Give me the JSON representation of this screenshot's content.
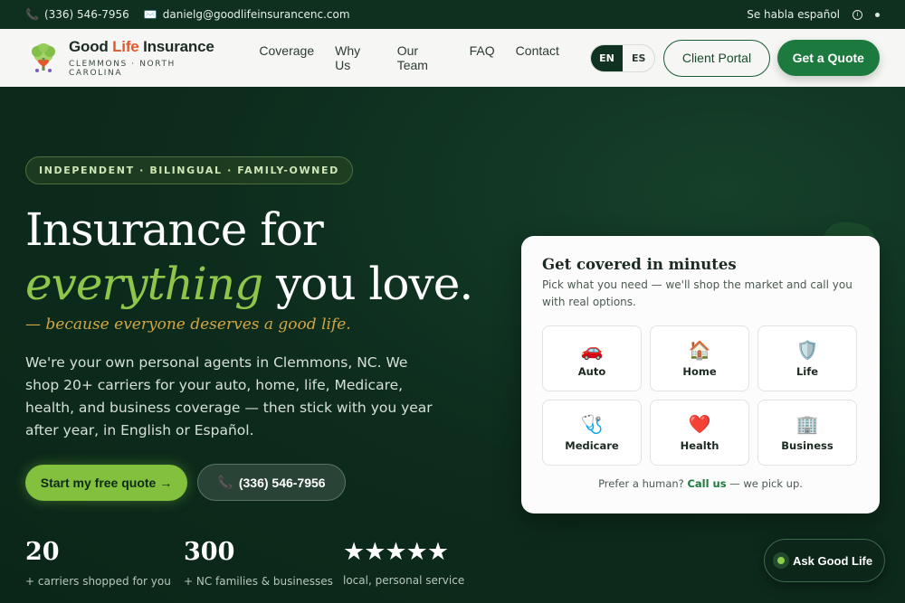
{
  "topbar": {
    "phone": "(336) 546-7956",
    "email": "danielg@goodlifeinsurancenc.com",
    "spanish": "Se habla español",
    "phone_icon": "phone-icon",
    "email_icon": "envelope-icon"
  },
  "header": {
    "brand_good": "Good",
    "brand_life": "Life",
    "brand_insurance": "Insurance",
    "brand_sub": "CLEMMONS · NORTH CAROLINA",
    "nav": [
      "Coverage",
      "Why Us",
      "Our Team",
      "FAQ",
      "Contact"
    ],
    "lang_en": "EN",
    "lang_es": "ES",
    "portal": "Client Portal",
    "quote": "Get a Quote"
  },
  "hero": {
    "badge": "INDEPENDENT · BILINGUAL · FAMILY-OWNED",
    "title_line1": "Insurance for",
    "title_accent": "everything",
    "title_rest": "you love.",
    "tagline": "— because everyone deserves a good life.",
    "lead": "We're your own personal agents in Clemmons, NC. We shop 20+ carriers for your auto, home, life, Medicare, health, and business coverage — then stick with you year after year, in English or Español.",
    "cta_primary": "Start my free quote →",
    "cta_phone": "(336) 546-7956",
    "stats": [
      {
        "num": "20",
        "label": "+ carriers shopped for you"
      },
      {
        "num": "300",
        "label": "+ NC families & businesses"
      },
      {
        "stars": "★★★★★",
        "label": "local, personal service",
        "rating": 5
      }
    ]
  },
  "card": {
    "title": "Get covered in minutes",
    "subtitle": "Pick what you need — we'll shop the market and call you with real options.",
    "tiles": [
      {
        "label": "Auto",
        "icon": "🚗",
        "icon_name": "car-icon"
      },
      {
        "label": "Home",
        "icon": "🏠",
        "icon_name": "house-icon"
      },
      {
        "label": "Life",
        "icon": "🛡️",
        "icon_name": "shield-icon"
      },
      {
        "label": "Medicare",
        "icon": "🩺",
        "icon_name": "stethoscope-icon"
      },
      {
        "label": "Health",
        "icon": "❤️",
        "icon_name": "heart-icon"
      },
      {
        "label": "Business",
        "icon": "🏢",
        "icon_name": "building-icon"
      }
    ],
    "foot_pre": "Prefer a human?",
    "foot_link": "Call us",
    "foot_post": "— we pick up."
  },
  "chat": {
    "label": "Ask Good Life"
  },
  "colors": {
    "dark_green": "#0c2a1b",
    "accent_green": "#8fc54a",
    "button_green": "#1d7a3e",
    "gold": "#d1a545",
    "brand_orange": "#e2582b"
  }
}
